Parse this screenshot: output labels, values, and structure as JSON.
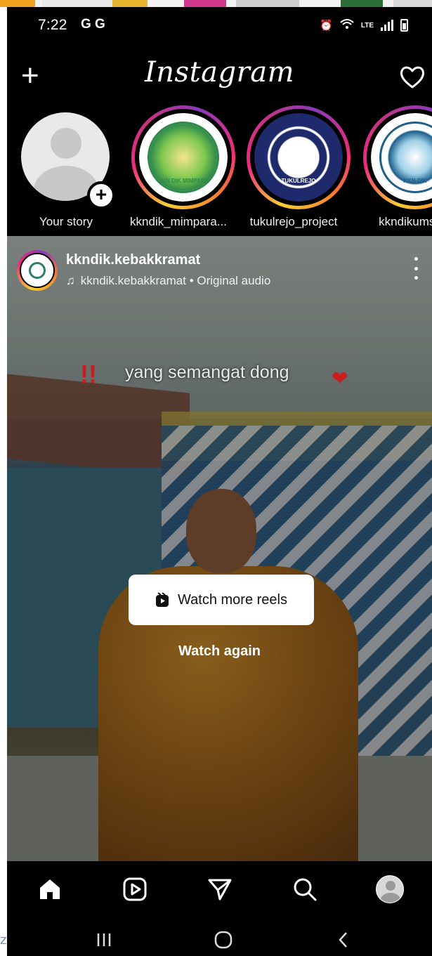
{
  "status_bar": {
    "time": "7:22",
    "carrier_icons": "G G",
    "network": "LTE"
  },
  "header": {
    "logo": "Instagram",
    "create_icon": "plus-icon",
    "notifications_icon": "heart-icon"
  },
  "stories": [
    {
      "label": "Your story",
      "type": "own"
    },
    {
      "label": "kkndik_mimpara...",
      "type": "seal",
      "seal_text": "KKN DIK MIMPARA",
      "seal_color": "#2f8a4a"
    },
    {
      "label": "tukulrejo_project",
      "type": "seal",
      "seal_text": "TUKULREJO",
      "seal_color": "#1e2a6b"
    },
    {
      "label": "kkndikums_",
      "type": "seal",
      "seal_text": "KKN DIK",
      "seal_color": "#1f5f8a"
    }
  ],
  "post": {
    "username": "kkndik.kebakkramat",
    "audio": "kkndik.kebakkramat • Original audio",
    "caption": "yang semangat dong",
    "watch_more_label": "Watch more reels",
    "watch_again_label": "Watch again"
  },
  "bottom_nav": [
    "home-icon",
    "reels-icon",
    "direct-icon",
    "search-icon",
    "profile-avatar"
  ],
  "system_nav": [
    "recent-apps-icon",
    "home-circle-icon",
    "back-icon"
  ],
  "colors": {
    "background": "#000000",
    "text": "#ffffff",
    "story_ring_start": "#f9ce34",
    "story_ring_mid": "#ee2a7b",
    "story_ring_end": "#8a3ab9"
  }
}
